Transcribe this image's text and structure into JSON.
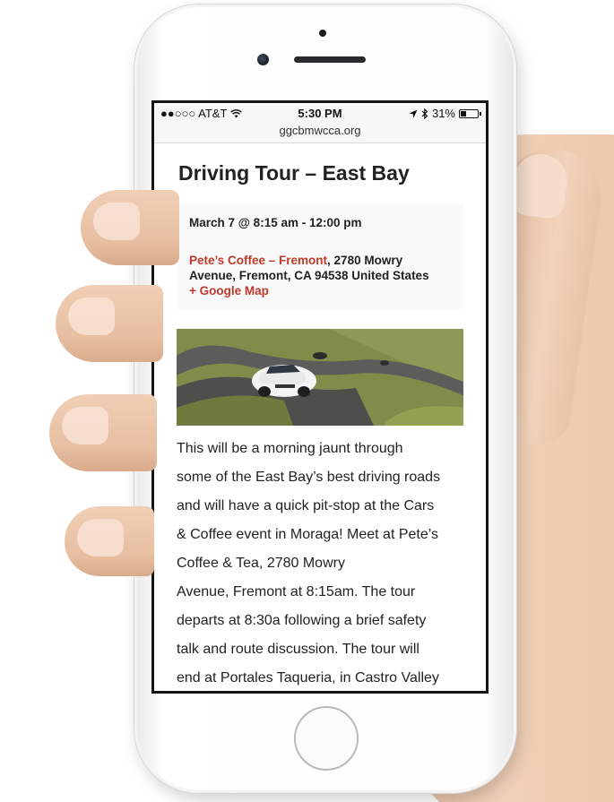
{
  "statusbar": {
    "carrier": "●●○○○ AT&T",
    "wifi_icon": "wifi-icon",
    "time": "5:30 PM",
    "battery": "31%",
    "battery_level": 0.31
  },
  "browser": {
    "url": "ggcbmwcca.org"
  },
  "event": {
    "title": "Driving Tour – East Bay",
    "date": "March 7 @ 8:15 am - 12:00 pm",
    "venue_name": "Pete’s Coffee – Fremont",
    "address": ", 2780 Mowry Avenue, Fremont, CA 94538 United States",
    "map_link": "+ Google Map",
    "description_lines": [
      "This will be a morning jaunt through",
      "some of the East Bay’s best driving roads",
      "and will have a quick pit-stop at the Cars",
      "& Coffee event in Moraga! Meet at Pete’s",
      "Coffee & Tea, 2780 Mowry",
      "Avenue, Fremont at 8:15am.  The tour",
      "departs at 8:30a following a brief safety",
      "talk and route discussion. The tour will",
      "end at Portales Taqueria, in Castro Valley"
    ]
  },
  "colors": {
    "link_red": "#c0392b",
    "text": "#222222"
  }
}
